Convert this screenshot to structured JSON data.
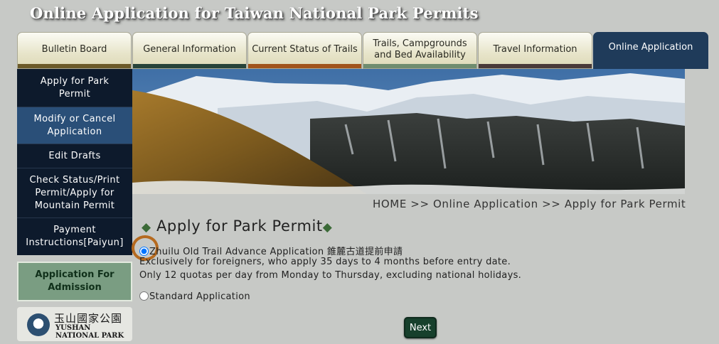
{
  "header": {
    "title": "Online Application for Taiwan National Park Permits"
  },
  "tabs": [
    {
      "label": "Bulletin Board",
      "active": false,
      "bar_color": "#6b5a2a"
    },
    {
      "label": "General Information",
      "active": false,
      "bar_color": "#27433a"
    },
    {
      "label": "Current Status of Trails",
      "active": false,
      "bar_color": "#a1541c"
    },
    {
      "label": "Trails, Campgrounds and Bed Availability",
      "active": false,
      "bar_color": "#6f8c6f"
    },
    {
      "label": "Travel Information",
      "active": false,
      "bar_color": "#4a3b3a"
    },
    {
      "label": "Online Application",
      "active": true,
      "bar_color": "#1f3b5a"
    }
  ],
  "sidebar": {
    "items": [
      {
        "label": "Apply for Park Permit",
        "selected": false
      },
      {
        "label": "Modify or Cancel Application",
        "selected": true
      },
      {
        "label": "Edit Drafts",
        "selected": false
      },
      {
        "label": "Check Status/Print Permit/Apply for Mountain Permit",
        "selected": false
      },
      {
        "label": "Payment Instructions[Paiyun]",
        "selected": false
      }
    ],
    "admission_label": "Application For Admission",
    "logo": {
      "cn": "玉山國家公園",
      "en_line1": "YUSHAN",
      "en_line2": "NATIONAL PARK"
    }
  },
  "breadcrumb": "HOME >> Online Application >> Apply for Park Permit",
  "main": {
    "title": "Apply for Park Permit",
    "title_marker": "◆",
    "options": [
      {
        "label": "Zhuilu Old Trail Advance Application 錐麓古道提前申請",
        "checked": true,
        "notes": [
          "Exclusively for foreigners, who apply 35 days to 4 months before entry date.",
          "Only 12 quotas per day from Monday to Thursday, excluding national holidays."
        ]
      },
      {
        "label": "Standard Application",
        "checked": false
      }
    ],
    "next_label": "Next"
  },
  "colors": {
    "background": "#c7c9c6",
    "nav_dark": "#0d1a2c",
    "nav_selected": "#2a4f78",
    "active_tab": "#1f3b5a",
    "admission_bg": "#7a9d82",
    "next_button": "#17402c",
    "highlight_ring": "#b56a1f"
  }
}
